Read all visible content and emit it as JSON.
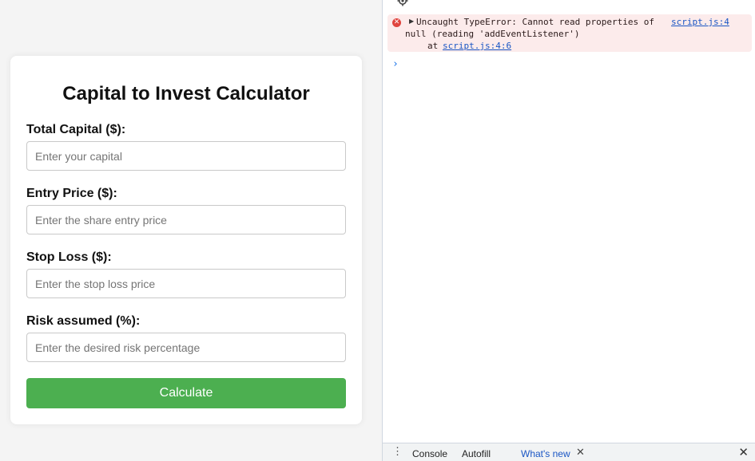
{
  "calculator": {
    "title": "Capital to Invest Calculator",
    "fields": [
      {
        "label": "Total Capital ($):",
        "placeholder": "Enter your capital",
        "value": ""
      },
      {
        "label": "Entry Price ($):",
        "placeholder": "Enter the share entry price",
        "value": ""
      },
      {
        "label": "Stop Loss ($):",
        "placeholder": "Enter the stop loss price",
        "value": ""
      },
      {
        "label": "Risk assumed (%):",
        "placeholder": "Enter the desired risk percentage",
        "value": ""
      }
    ],
    "button_label": "Calculate",
    "button_color": "#4caf50"
  },
  "devtools": {
    "error": {
      "line1": "Uncaught TypeError: Cannot read properties of",
      "line2": "null (reading 'addEventListener')",
      "line3_prefix": "at ",
      "source_link": "script.js:4",
      "stack_link": "script.js:4:6",
      "icon": "error-circle-icon"
    },
    "prompt_symbol": "›",
    "drawer": {
      "tabs": [
        "Console",
        "Autofill",
        "What's new"
      ],
      "active_tab": "What's new",
      "menu_icon": "kebab-menu-icon",
      "close_icon": "close-icon"
    }
  }
}
